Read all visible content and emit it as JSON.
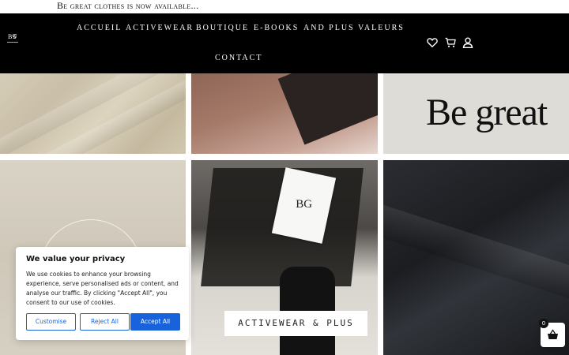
{
  "announcement": {
    "text": "Be great clothes is now available..."
  },
  "header": {
    "nav": [
      {
        "label": "ACCUEIL"
      },
      {
        "label": "ACTIVEWEAR"
      },
      {
        "label": "BOUTIQUE"
      },
      {
        "label": "E-BOOKS"
      },
      {
        "label": "AND PLUS"
      },
      {
        "label": "VALEURS"
      },
      {
        "label": "CONTACT"
      }
    ],
    "icons": [
      "heart-icon",
      "cart-icon",
      "user-icon"
    ]
  },
  "gallery": {
    "be_great_text": "Be great",
    "caption": "ACTIVEWEAR & PLUS"
  },
  "cookie_banner": {
    "title": "We value your privacy",
    "body": "We use cookies to enhance your browsing experience, serve personalised ads or content, and analyse our traffic. By clicking \"Accept All\", you consent to our use of cookies.",
    "customise_label": "Customise",
    "reject_label": "Reject All",
    "accept_label": "Accept All"
  },
  "cart_widget": {
    "count": "0"
  },
  "colors": {
    "header_bg": "#000000",
    "accent_blue": "#1863dc"
  }
}
